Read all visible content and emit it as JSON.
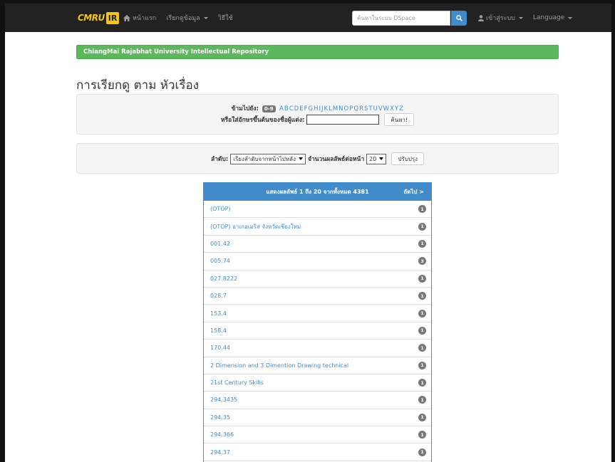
{
  "navbar": {
    "logo_text": "CMRU",
    "logo_badge": "IR",
    "home": "หน้าแรก",
    "browse": "เรียกดูข้อมูล",
    "help": "วิธีใช้",
    "search_placeholder": "ค้นหาในระบบ DSpace",
    "login": "เข้าสู่ระบบ",
    "language": "Language"
  },
  "banner": "ChiangMai Rajabhat University Intellectual Repository",
  "page_title": "การเรียกดู ตาม หัวเรื่อง",
  "jump": {
    "label": "ข้ามไปยัง:",
    "badge": "0-9",
    "letters": [
      "A",
      "B",
      "C",
      "D",
      "E",
      "F",
      "G",
      "H",
      "I",
      "J",
      "K",
      "L",
      "M",
      "N",
      "O",
      "P",
      "Q",
      "R",
      "S",
      "T",
      "U",
      "V",
      "W",
      "X",
      "Y",
      "Z"
    ],
    "starts_label": "หรือใส่อักษรขึ้นต้นของชื่อผู้แต่ง:",
    "starts_value": "",
    "go_button": "ค้นหา!"
  },
  "sort": {
    "order_label": "ลำดับ:",
    "order_value": "เรียงลำดับจากหน้าไปหลัง",
    "rpp_label": "จำนวนผลลัพธ์ต่อหน้า",
    "rpp_value": "20",
    "update_button": "ปรับปรุง"
  },
  "results": {
    "heading": "แสดงผลลัพธ์ 1 ถึง 20 จากทั้งหมด 4381",
    "next": "ถัดไป >",
    "items": [
      {
        "label": "(OTOP)",
        "count": "1"
      },
      {
        "label": "(OTOP) อาเกอเมริส จังหวัดเชียงใหม่",
        "count": "1"
      },
      {
        "label": "001.42",
        "count": "1"
      },
      {
        "label": "005.74",
        "count": "3"
      },
      {
        "label": "027.8222",
        "count": "1"
      },
      {
        "label": "028.7",
        "count": "1"
      },
      {
        "label": "153.4",
        "count": "1"
      },
      {
        "label": "158.4",
        "count": "1"
      },
      {
        "label": "170.44",
        "count": "1"
      },
      {
        "label": "2 Dimension and 3 Dimention Drawing technical",
        "count": "1"
      },
      {
        "label": "21st Century Skills",
        "count": "1"
      },
      {
        "label": "294.3435",
        "count": "1"
      },
      {
        "label": "294.35",
        "count": "1"
      },
      {
        "label": "294.366",
        "count": "1"
      },
      {
        "label": "294.37",
        "count": "1"
      },
      {
        "label": "",
        "count": ""
      }
    ]
  }
}
